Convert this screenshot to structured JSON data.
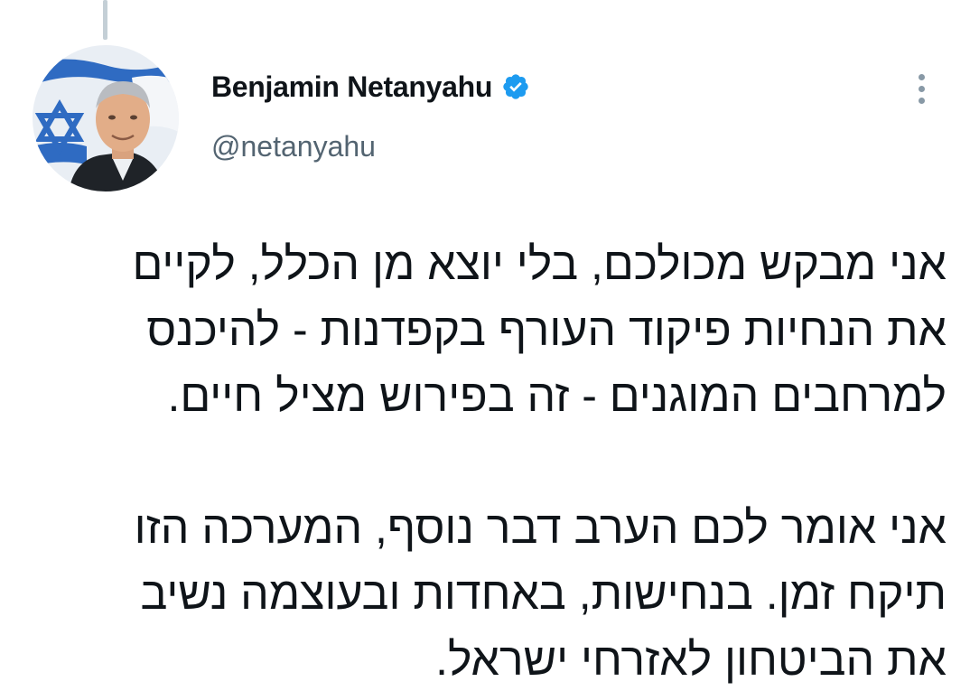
{
  "author": {
    "display_name": "Benjamin Netanyahu",
    "handle": "@netanyahu",
    "verified": true,
    "verified_color": "#1d9bf0"
  },
  "icons": {
    "verified": "verified-badge-icon",
    "more": "more-options-icon",
    "avatar": "profile-photo"
  },
  "tweet": {
    "paragraph_1": [
      "אני מבקש מכולכם, בלי יוצא מן הכלל, לקיים",
      "את הנחיות פיקוד העורף בקפדנות - להיכנס",
      "למרחבים המוגנים - זה בפירוש מציל חיים."
    ],
    "paragraph_2": [
      "אני אומר לכם הערב דבר נוסף, המערכה הזו",
      "תיקח זמן. בנחישות, באחדות ובעוצמה נשיב",
      "את הביטחון לאזרחי ישראל."
    ]
  }
}
